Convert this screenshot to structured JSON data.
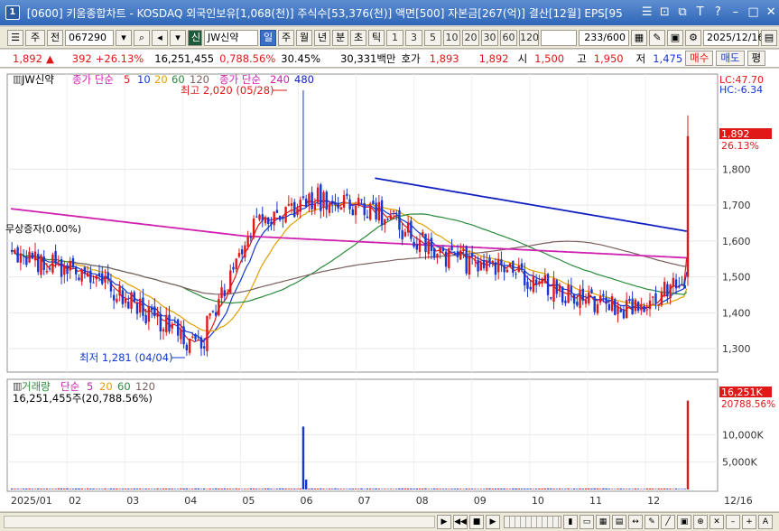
{
  "window": {
    "app_badge": "1",
    "title": "[0600] 키움종합차트 - KOSDAQ 외국인보유[1,068(천)] 주식수[53,376(천)] 액면[500] 자본금[267(억)] 결산[12월] EPS[95"
  },
  "toolbar": {
    "period_type": "주",
    "prev_label": "전",
    "code": "067290",
    "market_badge": "신",
    "stock_name": "JW신약",
    "period_buttons": [
      "일",
      "주",
      "월",
      "년",
      "분",
      "초",
      "틱"
    ],
    "selected_period": "일",
    "intervals": [
      "1",
      "3",
      "5",
      "10",
      "20",
      "30",
      "60",
      "120"
    ],
    "count": "233/600",
    "date": "2025/12/16"
  },
  "quote": {
    "price": "1,892",
    "change_arrow": "▲",
    "change": "392",
    "change_pct": "+26.13%",
    "volume": "16,251,455",
    "volume_ratio": "0,788.56%",
    "turnover": "30.45%",
    "amount": "30,331백만",
    "ask_label": "호가",
    "ask": "1,893",
    "bid": "1,892",
    "open_label": "시",
    "open": "1,500",
    "high_label": "고",
    "high": "1,950",
    "low_label": "저",
    "low": "1,475",
    "buy_label": "매수",
    "sell_label": "매도",
    "eval_label": "평"
  },
  "price_panel": {
    "stock_tag": "JW신약",
    "legend_ma_label": "종가 단순",
    "legend_ma_periods": [
      "5",
      "10",
      "20",
      "60",
      "120"
    ],
    "legend_ma2_label": "종가 단순",
    "legend_ma2_periods": [
      "240",
      "480"
    ],
    "lc_label": "LC:47.70",
    "hc_label": "HC:-6.34",
    "high_annotation": "최고 2,020 (05/28)",
    "low_annotation": "최저 1,281 (04/04)",
    "event_annotation": "무상증자(0.00%)",
    "current_price_tag": "1,892",
    "current_pct_tag": "26.13%"
  },
  "volume_panel": {
    "legend_label": "거래량",
    "legend_ma_label": "단순",
    "legend_periods": [
      "5",
      "20",
      "60",
      "120"
    ],
    "volume_text": "16,251,455주(20,788.56%)",
    "current_tag": "16,251K",
    "current_pct_tag": "20788.56%"
  },
  "x_axis": {
    "labels": [
      "2025/01",
      "02",
      "03",
      "04",
      "05",
      "06",
      "07",
      "08",
      "09",
      "10",
      "11",
      "12",
      "12/16"
    ]
  },
  "colors": {
    "up": "#e01818",
    "down": "#1438d0",
    "ma5": "#e01818",
    "ma10": "#1438d0",
    "ma20": "#e0a000",
    "ma60": "#2a8a3a",
    "ma120": "#7a6060",
    "ma240": "#d020b0",
    "ma480": "#1020c0"
  },
  "chart_data": {
    "type": "candlestick",
    "price_axis_ticks": [
      1300,
      1400,
      1500,
      1600,
      1700,
      1800
    ],
    "price_axis_labels": [
      "1,300",
      "1,400",
      "1,500",
      "1,600",
      "1,700",
      "1,800"
    ],
    "volume_axis_ticks": [
      5000,
      10000
    ],
    "volume_axis_labels": [
      "5,000K",
      "10,000K"
    ],
    "ylim": [
      1240,
      2060
    ],
    "months": [
      "2025/01",
      "02",
      "03",
      "04",
      "05",
      "06",
      "07",
      "08",
      "09",
      "10",
      "11",
      "12"
    ],
    "close_by_month": [
      1560,
      1520,
      1430,
      1300,
      1650,
      1720,
      1680,
      1560,
      1520,
      1460,
      1400,
      1500
    ],
    "last_close": 1892,
    "last_high": 1950,
    "last_open": 1500,
    "last_low": 1475,
    "high_point": 2020,
    "low_point": 1281,
    "last_volume_k": 16251,
    "spike_volume_k": 11500
  }
}
